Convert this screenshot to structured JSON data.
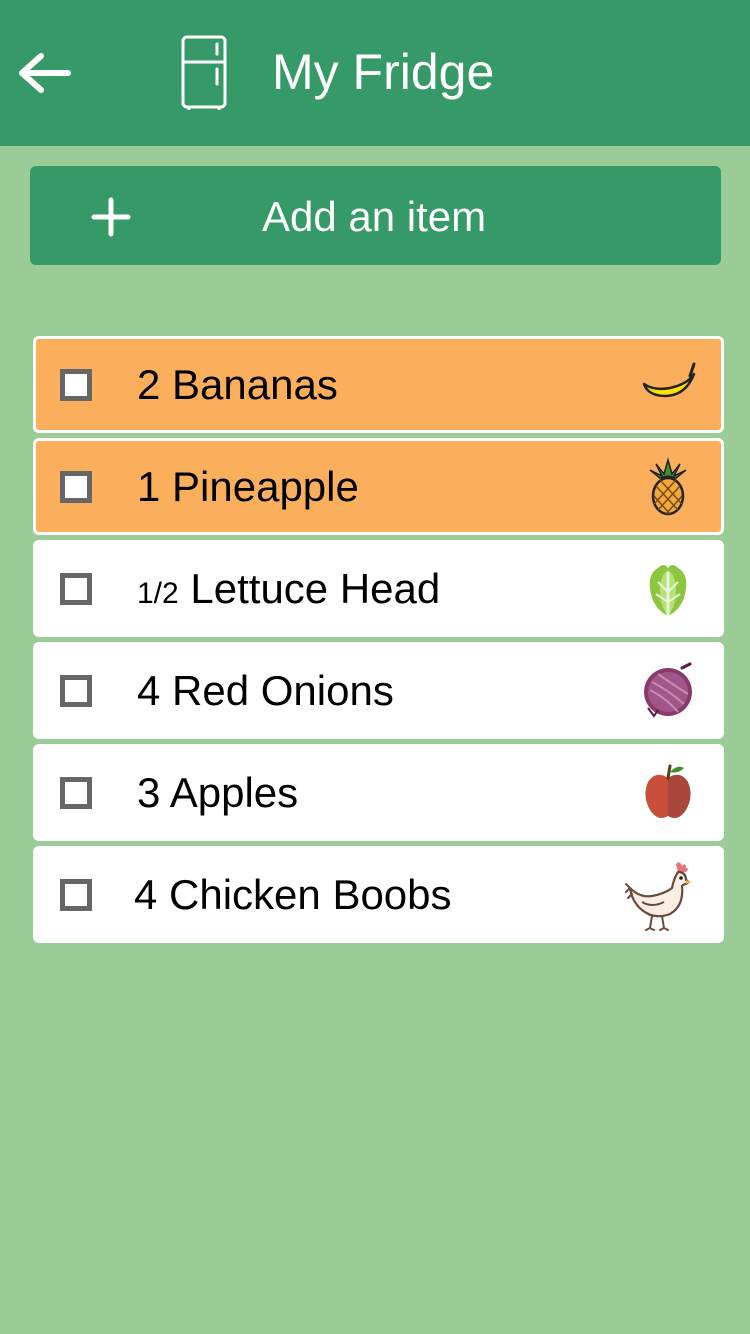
{
  "header": {
    "title": "My Fridge",
    "back_icon": "arrow-left-icon",
    "fridge_icon": "fridge-icon",
    "background": "#359a67"
  },
  "add_button": {
    "label": "Add an item",
    "icon": "plus-icon"
  },
  "items": [
    {
      "qty": "2",
      "name": "Bananas",
      "icon": "banana-icon",
      "highlighted": true,
      "checked": false
    },
    {
      "qty": "1",
      "name": "Pineapple",
      "icon": "pineapple-icon",
      "highlighted": true,
      "checked": false
    },
    {
      "qty": "1/2",
      "name": "Lettuce Head",
      "icon": "lettuce-icon",
      "highlighted": false,
      "checked": false
    },
    {
      "qty": "4",
      "name": "Red Onions",
      "icon": "red-onion-icon",
      "highlighted": false,
      "checked": false
    },
    {
      "qty": "3",
      "name": "Apples",
      "icon": "apple-icon",
      "highlighted": false,
      "checked": false
    },
    {
      "qty": "4",
      "name": "Chicken Boobs",
      "icon": "chicken-icon",
      "highlighted": false,
      "checked": false
    }
  ],
  "colors": {
    "background": "#9bcc98",
    "accent": "#359a67",
    "highlight": "#fbaf5d"
  }
}
